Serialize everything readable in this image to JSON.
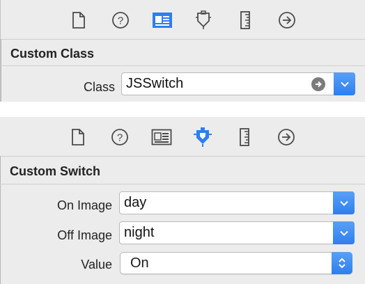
{
  "top_inspector": {
    "toolbar": {
      "icons": [
        "file-inspector-icon",
        "quick-help-icon",
        "identity-inspector-icon",
        "attributes-inspector-icon",
        "size-inspector-icon",
        "connections-inspector-icon"
      ],
      "selected": "identity-inspector-icon"
    },
    "section_title": "Custom Class",
    "class_label": "Class",
    "class_value": "JSSwitch"
  },
  "bottom_inspector": {
    "toolbar": {
      "icons": [
        "file-inspector-icon",
        "quick-help-icon",
        "identity-inspector-icon",
        "attributes-inspector-icon",
        "size-inspector-icon",
        "connections-inspector-icon"
      ],
      "selected": "attributes-inspector-icon"
    },
    "section_title": "Custom Switch",
    "on_image_label": "On Image",
    "on_image_value": "day",
    "off_image_label": "Off Image",
    "off_image_value": "night",
    "value_label": "Value",
    "value_value": "On"
  },
  "colors": {
    "accent": "#2e7ef0",
    "panel_bg": "#ececec",
    "icon_gray": "#4a4a4a"
  }
}
